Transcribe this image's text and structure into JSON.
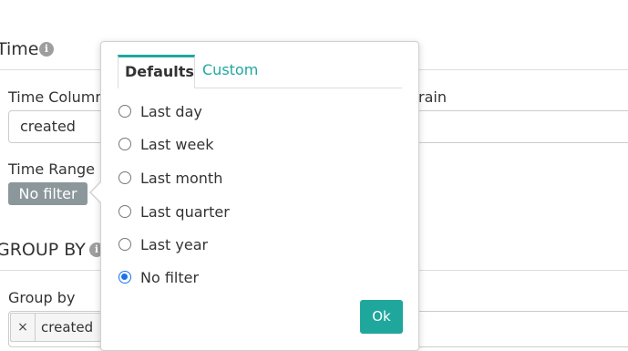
{
  "time_section": {
    "title": "Time",
    "time_column": {
      "label": "Time Column",
      "value": "created"
    },
    "time_grain": {
      "label_fragment": "rain"
    },
    "time_range": {
      "label": "Time Range",
      "value": "No filter"
    }
  },
  "group_by_section": {
    "title": "GROUP BY",
    "group_by": {
      "label": "Group by",
      "tags": [
        "created"
      ],
      "remove_glyph": "×"
    }
  },
  "popover": {
    "tabs": [
      {
        "label": "Defaults",
        "active": true
      },
      {
        "label": "Custom",
        "active": false
      }
    ],
    "options": [
      {
        "label": "Last day",
        "checked": false
      },
      {
        "label": "Last week",
        "checked": false
      },
      {
        "label": "Last month",
        "checked": false
      },
      {
        "label": "Last quarter",
        "checked": false
      },
      {
        "label": "Last year",
        "checked": false
      },
      {
        "label": "No filter",
        "checked": true
      }
    ],
    "ok_label": "Ok"
  },
  "icons": {
    "info": "i"
  },
  "colors": {
    "accent": "#20a7a1",
    "ok_button": "#1fa79d",
    "badge_bg": "#8c979c",
    "radio_checked": "#1a73e8"
  }
}
